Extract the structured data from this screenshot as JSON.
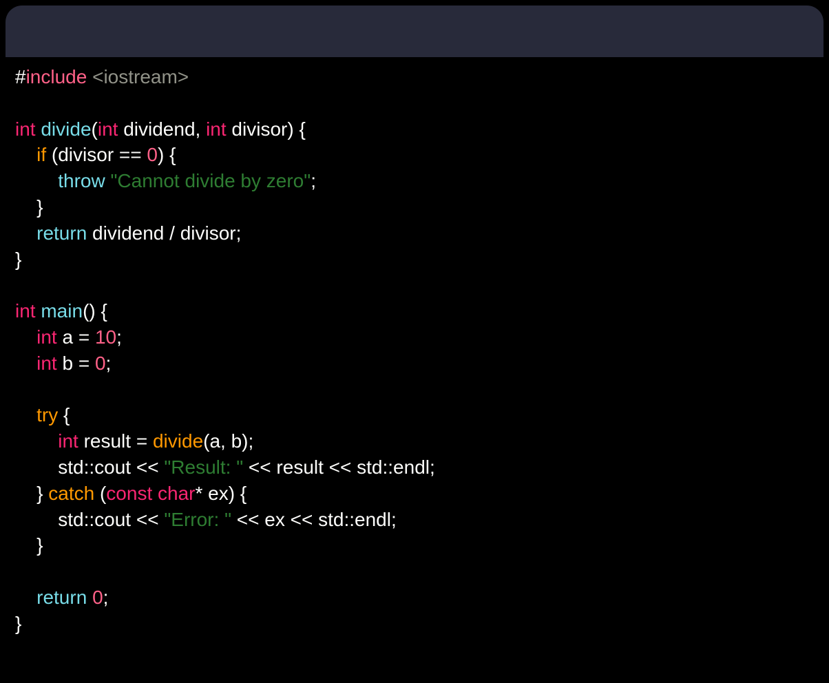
{
  "code": {
    "line1": {
      "hash": "#",
      "incl": "include",
      "hdr": " <iostream>"
    },
    "line2": "",
    "line3": {
      "t1": "int",
      "sp1": " ",
      "fn": "divide",
      "op": "(",
      "t2": "int",
      "p1": " dividend, ",
      "t3": "int",
      "p2": " divisor) {"
    },
    "line4": {
      "ind": "    ",
      "kw": "if",
      "rest": " (divisor == ",
      "num": "0",
      "end": ") {"
    },
    "line5": {
      "ind": "        ",
      "kw": "throw",
      "sp": " ",
      "str": "\"Cannot divide by zero\"",
      "end": ";"
    },
    "line6": "    }",
    "line7": {
      "ind": "    ",
      "kw": "return",
      "rest": " dividend / divisor;"
    },
    "line8": "}",
    "line9": "",
    "line10": {
      "t1": "int",
      "sp": " ",
      "fn": "main",
      "rest": "() {"
    },
    "line11": {
      "ind": "    ",
      "t": "int",
      "mid": " a = ",
      "num": "10",
      "end": ";"
    },
    "line12": {
      "ind": "    ",
      "t": "int",
      "mid": " b = ",
      "num": "0",
      "end": ";"
    },
    "line13": "",
    "line14": {
      "ind": "    ",
      "kw": "try",
      "rest": " {"
    },
    "line15": {
      "ind": "        ",
      "t": "int",
      "mid": " result = ",
      "fn": "divide",
      "rest": "(a, b);"
    },
    "line16": {
      "ind": "        std::cout << ",
      "str": "\"Result: \"",
      "rest": " << result << std::endl;"
    },
    "line17": {
      "ind": "    } ",
      "kw": "catch",
      "mid": " (",
      "kw2": "const",
      "mid2": " ",
      "t": "char",
      "rest": "* ex) {"
    },
    "line18": {
      "ind": "        std::cout << ",
      "str": "\"Error: \"",
      "rest": " << ex << std::endl;"
    },
    "line19": "    }",
    "line20": "",
    "line21": {
      "ind": "    ",
      "kw": "return",
      "sp": " ",
      "num": "0",
      "end": ";"
    },
    "line22": "}"
  }
}
